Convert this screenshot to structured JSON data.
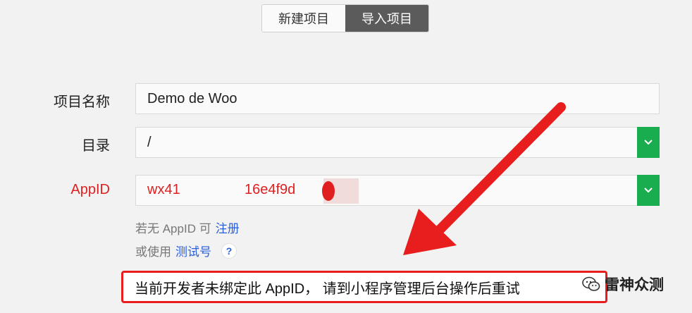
{
  "tabs": [
    {
      "label": "新建项目",
      "active": false
    },
    {
      "label": "导入项目",
      "active": true
    }
  ],
  "form": {
    "project_name_label": "项目名称",
    "project_name_value": "Demo de Woo",
    "directory_label": "目录",
    "directory_value": "/",
    "appid_label": "AppID",
    "appid_value_start": "wx41",
    "appid_value_end": "16e4f9d"
  },
  "hints": {
    "no_appid_text": "若无 AppID 可",
    "register_link": "注册",
    "or_use_text": "或使用",
    "test_account_link": "测试号",
    "help_symbol": "?"
  },
  "alert": {
    "message": "当前开发者未绑定此 AppID， 请到小程序管理后台操作后重试"
  },
  "watermark": {
    "text": "雷神众测"
  },
  "colors": {
    "accent_green": "#1aad50",
    "error_red": "#e02020",
    "link_blue": "#2b5fd9",
    "active_tab": "#5b5b5b"
  }
}
